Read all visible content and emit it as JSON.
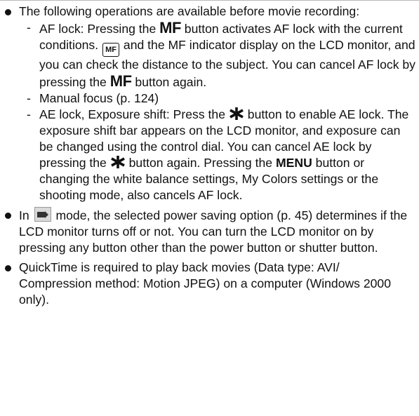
{
  "bullets": {
    "b1_intro": "The following operations are available before movie recording:",
    "sub_af_lock": {
      "part1": "AF lock: Pressing the",
      "mf_label": "MF",
      "part2": "button activates AF lock with the current conditions.",
      "mf_box_label": "MF",
      "part3": "and the MF indicator display on the LCD monitor, and you can check the distance to the subject. You can cancel AF lock by pressing the",
      "mf_label2": "MF",
      "part4": "button again."
    },
    "sub_manual_focus": "Manual focus (p. 124)",
    "sub_ae_lock": {
      "part1": "AE lock, Exposure shift: Press the",
      "part2": "button to enable AE lock. The exposure shift bar appears on the LCD monitor, and exposure can be changed using the control dial. You can cancel AE lock by pressing the",
      "part3": "button again. Pressing the",
      "menu_label": "MENU",
      "part4": "button or changing the white balance settings, My Colors settings or the shooting mode, also cancels AF lock."
    },
    "b2": {
      "part1": "In",
      "part2": "mode, the selected power saving option (p. 45) determines if the LCD monitor turns off or not. You can turn the LCD monitor on by pressing any button other than the power button or shutter button."
    },
    "b3": "QuickTime is required to play back movies (Data type: AVI/ Compression method: Motion JPEG) on a computer (Windows 2000 only).",
    "dash": "-"
  },
  "icons": {
    "mf_box": "mf-indicator-icon",
    "ae_lock": "asterisk-ae-lock-icon",
    "movie_mode": "movie-mode-icon"
  }
}
